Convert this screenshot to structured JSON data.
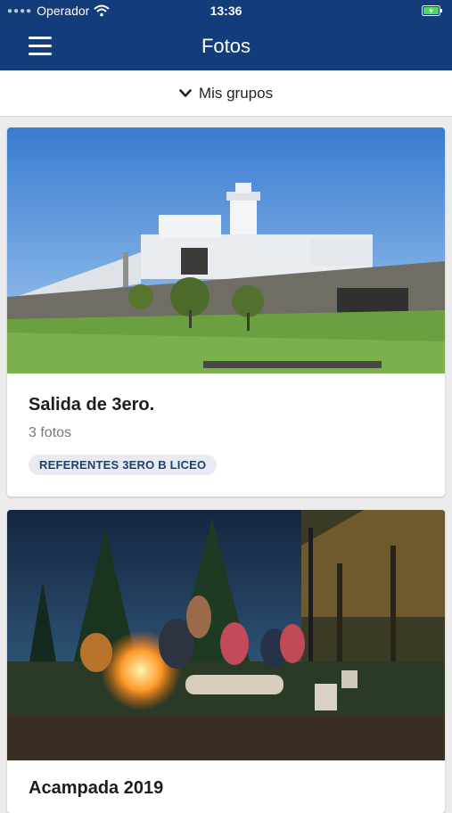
{
  "status_bar": {
    "carrier": "Operador",
    "time": "13:36",
    "wifi_icon": "wifi-icon",
    "battery_icon": "battery-charging-icon"
  },
  "header": {
    "title": "Fotos",
    "menu_icon": "hamburger-menu-icon"
  },
  "filter": {
    "label": "Mis grupos",
    "icon": "chevron-down-icon"
  },
  "albums": [
    {
      "title": "Salida de 3ero.",
      "count": "3 fotos",
      "group": "REFERENTES 3ERO B LICEO"
    },
    {
      "title": "Acampada 2019"
    }
  ],
  "colors": {
    "primary": "#123d7a",
    "badge_bg": "#e8ecf2",
    "badge_text": "#1d3f73",
    "page_bg": "#ececec"
  }
}
